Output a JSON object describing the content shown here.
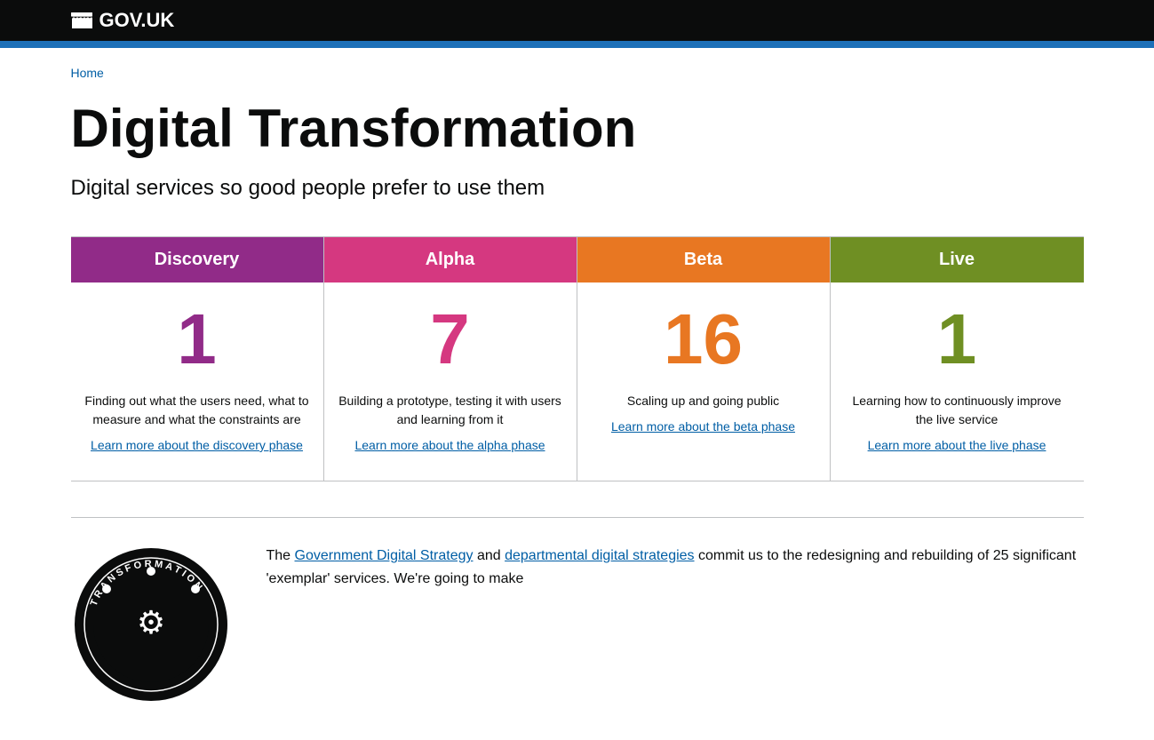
{
  "header": {
    "logo_text": "GOV.UK",
    "logo_href": "#"
  },
  "breadcrumb": {
    "home_label": "Home",
    "home_href": "#"
  },
  "page": {
    "title": "Digital Transformation",
    "subtitle": "Digital services so good people prefer to use them"
  },
  "phases": [
    {
      "id": "discovery",
      "label": "Discovery",
      "count": "1",
      "color_class": "discovery",
      "description": "Finding out what the users need, what to measure and what the constraints are",
      "link_text": "Learn more about the discovery phase",
      "link_href": "#"
    },
    {
      "id": "alpha",
      "label": "Alpha",
      "count": "7",
      "color_class": "alpha",
      "description": "Building a prototype, testing it with users and learning from it",
      "link_text": "Learn more about the alpha phase",
      "link_href": "#"
    },
    {
      "id": "beta",
      "label": "Beta",
      "count": "16",
      "color_class": "beta",
      "description": "Scaling up and going public",
      "link_text": "Learn more about the beta phase",
      "link_href": "#"
    },
    {
      "id": "live",
      "label": "Live",
      "count": "1",
      "color_class": "live",
      "description": "Learning how to continuously improve the live service",
      "link_text": "Learn more about the live phase",
      "link_href": "#"
    }
  ],
  "bottom": {
    "text_before_link1": "The ",
    "link1_text": "Government Digital Strategy",
    "link1_href": "#",
    "text_between": " and ",
    "link2_text": "departmental digital strategies",
    "link2_href": "#",
    "text_after": " commit us to the redesigning and rebuilding of 25 significant 'exemplar' services. We're going to make"
  }
}
